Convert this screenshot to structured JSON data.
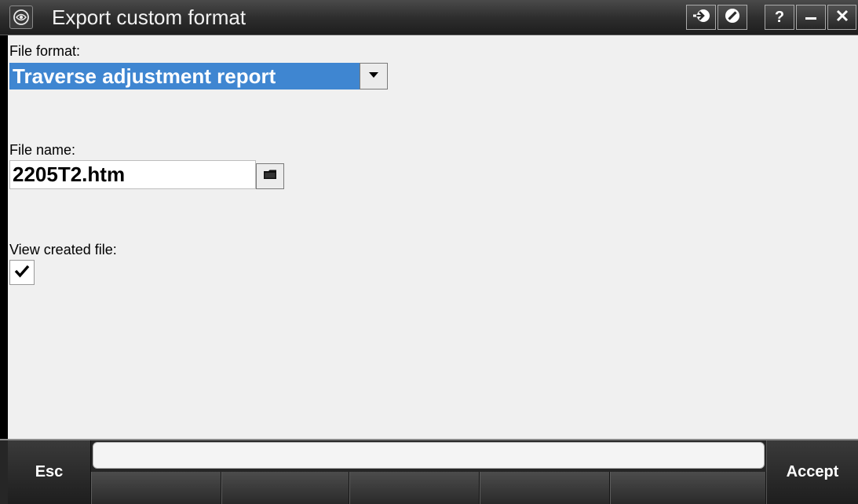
{
  "window": {
    "title": "Export custom format",
    "buttons": {
      "go": "go-icon",
      "cancel": "cancel-icon",
      "help": "?",
      "minimize": "minimize-icon",
      "close": "close-icon"
    }
  },
  "form": {
    "file_format_label": "File format:",
    "file_format_value": "Traverse adjustment report",
    "file_name_label": "File name:",
    "file_name_value": "2205T2.htm",
    "view_created_label": "View created file:",
    "view_created_checked": true
  },
  "softkeys": {
    "esc_label": "Esc",
    "accept_label": "Accept",
    "status_text": ""
  },
  "colors": {
    "selection": "#3f86d1",
    "background": "#f0f0f0",
    "titlebar": "#2c2c2c"
  }
}
